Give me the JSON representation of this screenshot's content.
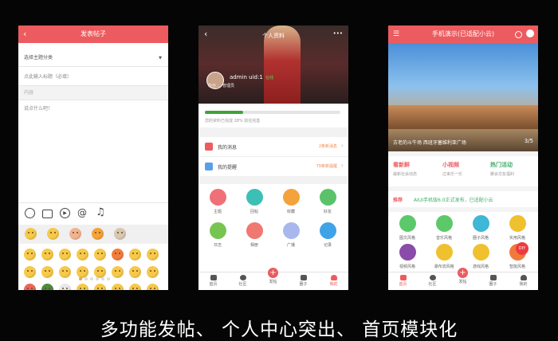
{
  "phone1": {
    "title": "发表帖子",
    "category_placeholder": "选择主题分类",
    "title_placeholder": "点此输入标题（必填）",
    "content_label": "内容",
    "content_placeholder": "说点什么吧！",
    "toolbar_icons": [
      "emoji-icon",
      "image-icon",
      "video-icon",
      "at-icon",
      "music-icon"
    ],
    "emoji_page_dots": 6
  },
  "phone2": {
    "title": "个人资料",
    "username": "admin uid:1",
    "online": "在线",
    "subline": "粉丝 ... 管理员",
    "progress_text": "您的资料已完成 28%  前往完善",
    "progress_fraction": 0.28,
    "menu": [
      {
        "label": "我的消息",
        "badge": "2条新消息",
        "color": "#ec5b5f"
      },
      {
        "label": "我的提醒",
        "badge": "79条新提醒",
        "color": "#5aa0e8"
      }
    ],
    "grid": [
      {
        "label": "主题",
        "color": "#f07078"
      },
      {
        "label": "回帖",
        "color": "#3cc0b5"
      },
      {
        "label": "收藏",
        "color": "#f3a23c"
      },
      {
        "label": "好友",
        "color": "#5cc26a"
      },
      {
        "label": "日志",
        "color": "#78c453"
      },
      {
        "label": "相册",
        "color": "#f07870"
      },
      {
        "label": "广播",
        "color": "#a9b7ee"
      },
      {
        "label": "记录",
        "color": "#3fa3e8"
      }
    ],
    "tabs": [
      "首页",
      "社区",
      "发帖",
      "圈子",
      "我的"
    ]
  },
  "phone3": {
    "title": "手机演示(已适配小云)",
    "banner_caption": "古老的斗牛场      西班牙塞维利亚广场",
    "banner_page": "3/5",
    "features": [
      {
        "title": "看新鲜",
        "sub": "最新社会动态",
        "color": "#ec5b5f"
      },
      {
        "title": "小视频",
        "sub": "过来乐一乐",
        "color": "#ec5b5f"
      },
      {
        "title": "热门活动",
        "sub": "聚会交友福利",
        "color": "#3fae6a"
      }
    ],
    "notice_tag": "推荐",
    "notice": "AIUI手机版6.0正式发布，已适配小云",
    "grid": [
      {
        "label": "图文风格",
        "color": "#5cc86a"
      },
      {
        "label": "音乐风格",
        "color": "#5cc86a"
      },
      {
        "label": "圈子风格",
        "color": "#3fb7d6"
      },
      {
        "label": "实用风格",
        "color": "#f0c12f"
      },
      {
        "label": "视频风格",
        "color": "#8a4ca8"
      },
      {
        "label": "瀑布流风格",
        "color": "#f0c12f"
      },
      {
        "label": "游戏风格",
        "color": "#f0c12f"
      },
      {
        "label": "智能风格",
        "color": "#f07a3c"
      }
    ],
    "diy_badge": "DIY",
    "tabs": [
      "首页",
      "社区",
      "发帖",
      "圈子",
      "我的"
    ]
  },
  "caption": "多功能发帖、 个人中心突出、 首页模块化"
}
